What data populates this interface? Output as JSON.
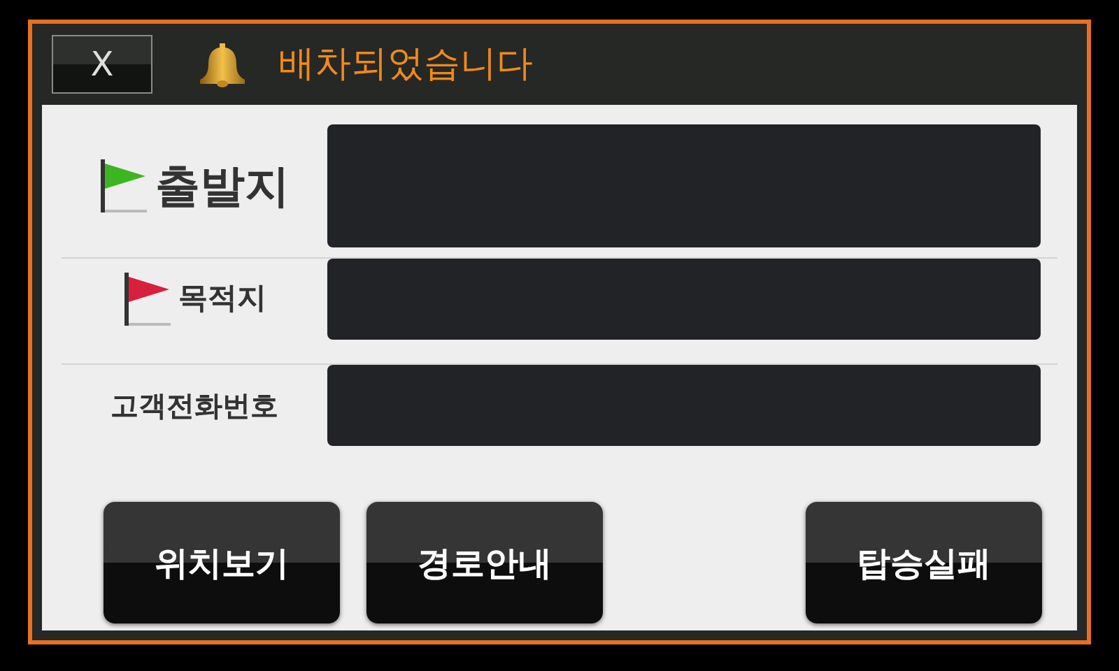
{
  "header": {
    "close_button": "X",
    "title": "배차되었습니다"
  },
  "fields": [
    {
      "kind": "origin",
      "label": "출발지",
      "color": "#3cb521"
    },
    {
      "kind": "destination",
      "label": "목적지",
      "color": "#d8203c"
    },
    {
      "kind": "phone",
      "label": "고객전화번호"
    }
  ],
  "buttons": [
    "위치보기",
    "경로안내",
    "탑승실패"
  ]
}
